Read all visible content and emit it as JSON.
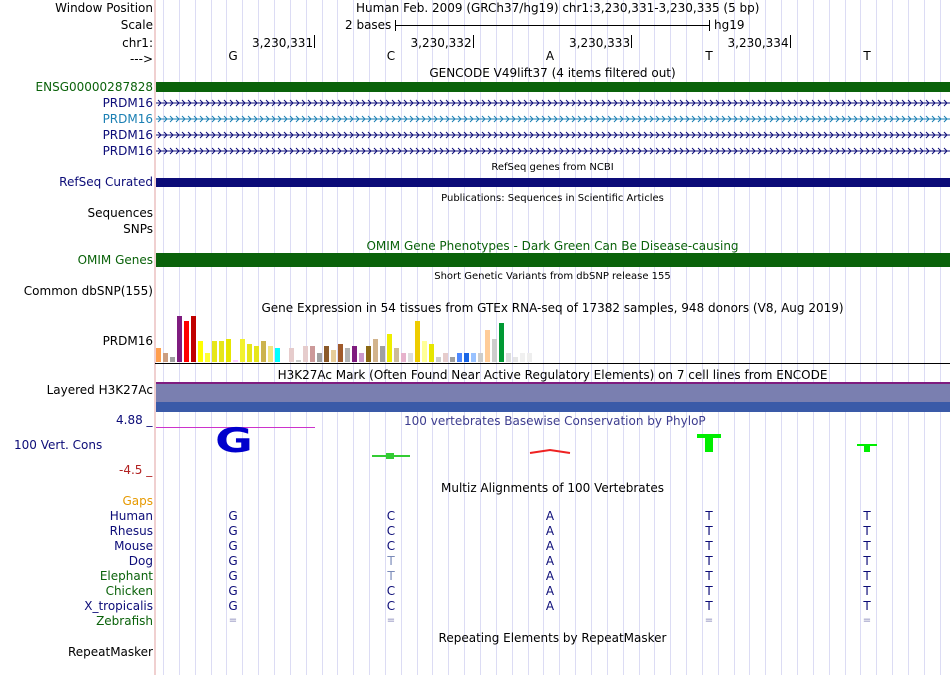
{
  "header": {
    "window_position_label": "Window Position",
    "scale_label": "Scale",
    "chrom_label": "chr1:",
    "strand_label": "--->",
    "assembly_text": "Human Feb. 2009 (GRCh37/hg19)   chr1:3,230,331-3,230,335 (5 bp)",
    "scale_text": "2 bases",
    "db_text": "hg19",
    "coords": [
      "3,230,331",
      "3,230,332",
      "3,230,333",
      "3,230,334"
    ],
    "bases": [
      "G",
      "C",
      "A",
      "T",
      "T"
    ]
  },
  "gencode": {
    "title": "GENCODE V49lift37 (4 items filtered out)",
    "items": [
      {
        "label": "ENSG00000287828",
        "color": "#0a620a"
      },
      {
        "label": "PRDM16",
        "color": "#0c0c78"
      },
      {
        "label": "PRDM16",
        "color": "#1a7fb3"
      },
      {
        "label": "PRDM16",
        "color": "#0c0c78"
      },
      {
        "label": "PRDM16",
        "color": "#0c0c78"
      }
    ]
  },
  "refseq": {
    "title": "RefSeq genes from NCBI",
    "label": "RefSeq Curated",
    "color": "#0c0c78"
  },
  "publications": {
    "title": "Publications: Sequences in Scientific Articles",
    "labels": [
      "Sequences",
      "SNPs"
    ]
  },
  "omim": {
    "title": "OMIM Gene Phenotypes - Dark Green Can Be Disease-causing",
    "label": "OMIM Genes",
    "color": "#0a620a"
  },
  "dbsnp": {
    "title": "Short Genetic Variants from dbSNP release 155",
    "label": "Common dbSNP(155)"
  },
  "gtex": {
    "title": "Gene Expression in 54 tissues from GTEx RNA-seq of 17382 samples, 948 donors (V8, Aug 2019)",
    "label": "PRDM16",
    "values": [
      0.3,
      0.2,
      0.1,
      1.0,
      0.9,
      1.0,
      0.45,
      0.2,
      0.45,
      0.45,
      0.5,
      0.05,
      0.5,
      0.4,
      0.35,
      0.45,
      0.35,
      0.3,
      0.3,
      0.3,
      0.05,
      0.35,
      0.35,
      0.2,
      0.35,
      0.25,
      0.4,
      0.3,
      0.35,
      0.2,
      0.35,
      0.5,
      0.35,
      0.6,
      0.3,
      0.2,
      0.2,
      0.9,
      0.45,
      0.4,
      0.1,
      0.2,
      0.1,
      0.2,
      0.2,
      0.2,
      0.2,
      0.7,
      0.5,
      0.85,
      0.2,
      0.1,
      0.2,
      0.2
    ],
    "colors": [
      "#ff9e4d",
      "#cc9e80",
      "#a0a0a0",
      "#7f1c7f",
      "#ff0000",
      "#c00000",
      "#ffff00",
      "#ffff33",
      "#e6e61a",
      "#e6e61a",
      "#e6e600",
      "#ffccff",
      "#f2f22e",
      "#e6e61a",
      "#e6e61a",
      "#ccb34d",
      "#f2e680",
      "#00ffff",
      "#ffffff",
      "#e6cccc",
      "#cccccc",
      "#e6cccc",
      "#cc9999",
      "#a0a0a0",
      "#8b5a2b",
      "#e6cc99",
      "#a05a2b",
      "#b3b3b3",
      "#7f1c7f",
      "#cc99cc",
      "#8b6914",
      "#d2b48c",
      "#a0a0a0",
      "#eeee00",
      "#ccbb99",
      "#e6b3cc",
      "#dddddd",
      "#eecc00",
      "#ffff99",
      "#e6e600",
      "#cccccc",
      "#e6cccc",
      "#a0a0a0",
      "#4d88ff",
      "#1a66e6",
      "#99c2ff",
      "#cccccc",
      "#ffcc99",
      "#cccccc",
      "#009933",
      "#dddddd",
      "#e6e6e6",
      "#f0f0f0",
      "#eeeeee"
    ]
  },
  "h3k27ac": {
    "title": "H3K27Ac Mark (Often Found Near Active Regulatory Elements) on 7 cell lines from ENCODE",
    "label": "Layered H3K27Ac"
  },
  "cons": {
    "title": "100 vertebrates Basewise Conservation by PhyloP",
    "label": "100 Vert. Cons",
    "max_label": "4.88 _",
    "min_label": "-4.5 _"
  },
  "multiz": {
    "title": "Multiz Alignments of 100 Vertebrates",
    "gaps_label": "Gaps",
    "species": [
      {
        "name": "Human",
        "color": "#0c0c78",
        "seq": [
          "G",
          "C",
          "A",
          "T",
          "T"
        ]
      },
      {
        "name": "Rhesus",
        "color": "#0c0c78",
        "seq": [
          "G",
          "C",
          "A",
          "T",
          "T"
        ]
      },
      {
        "name": "Mouse",
        "color": "#0c0c78",
        "seq": [
          "G",
          "C",
          "A",
          "T",
          "T"
        ]
      },
      {
        "name": "Dog",
        "color": "#0c0c78",
        "seq": [
          "G",
          "T",
          "A",
          "T",
          "T"
        ]
      },
      {
        "name": "Elephant",
        "color": "#0a620a",
        "seq": [
          "G",
          "T",
          "A",
          "T",
          "T"
        ]
      },
      {
        "name": "Chicken",
        "color": "#0a620a",
        "seq": [
          "G",
          "C",
          "A",
          "T",
          "T"
        ]
      },
      {
        "name": "X_tropicalis",
        "color": "#0c0c78",
        "seq": [
          "G",
          "C",
          "A",
          "T",
          "T"
        ]
      },
      {
        "name": "Zebrafish",
        "color": "#0a620a",
        "seq": [
          "=",
          "=",
          "",
          "=",
          "="
        ]
      }
    ]
  },
  "repeatmasker": {
    "title": "Repeating Elements by RepeatMasker",
    "label": "RepeatMasker"
  }
}
